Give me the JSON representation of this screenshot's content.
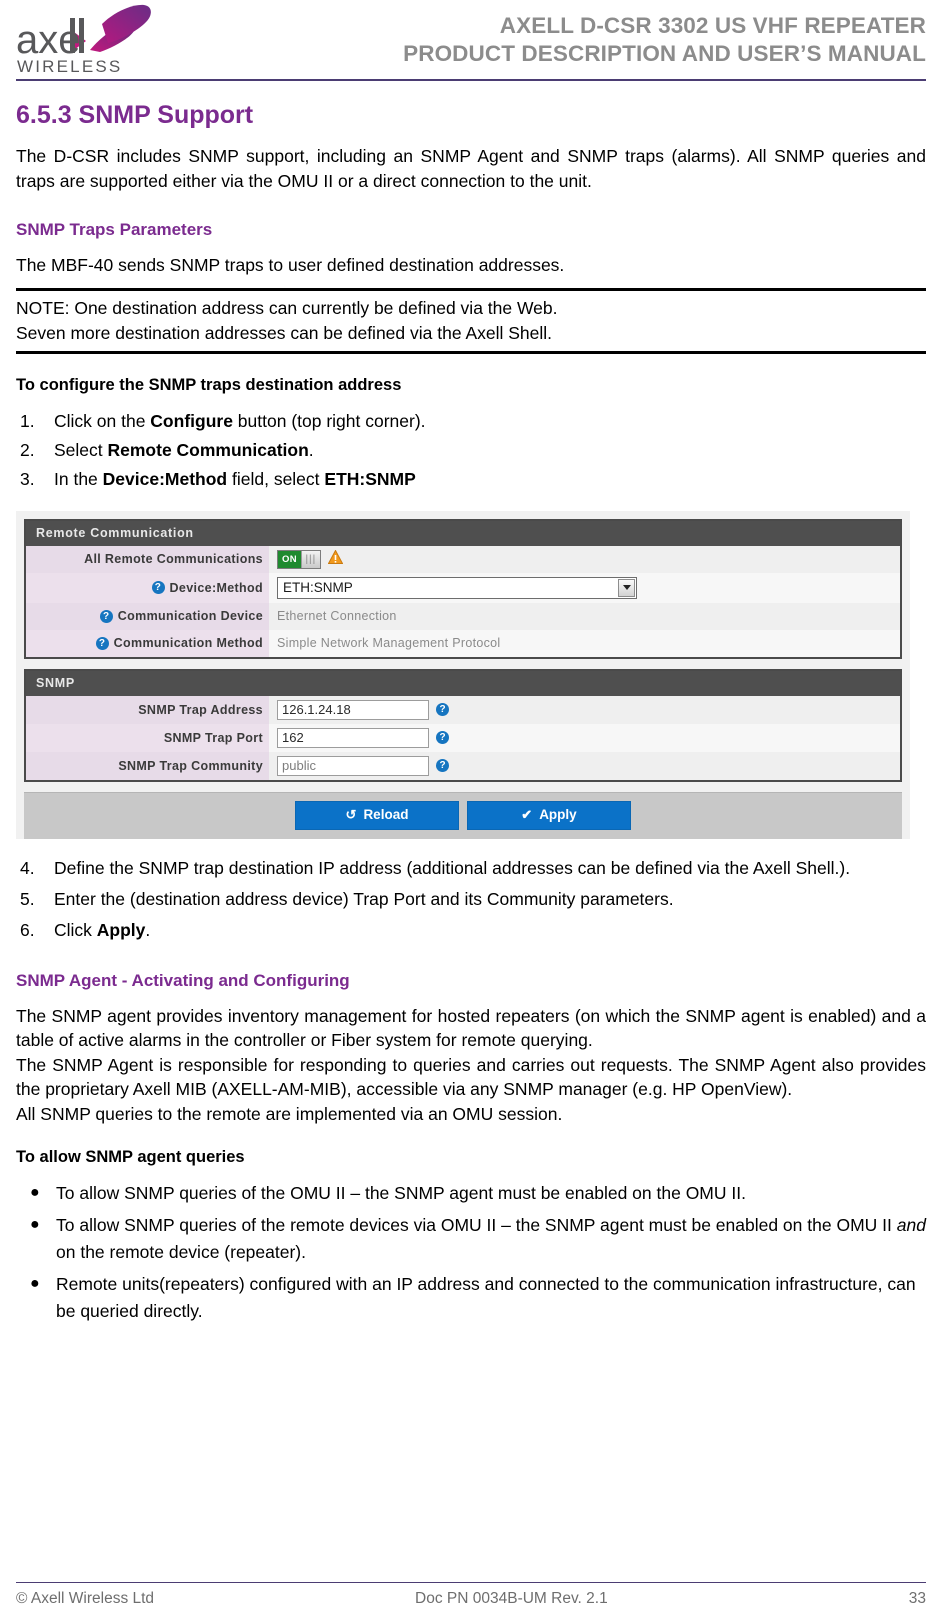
{
  "header": {
    "logo_word": "axell",
    "logo_sub": "WIRELESS",
    "title_line1": "AXELL D-CSR 3302 US VHF REPEATER",
    "title_line2": "PRODUCT DESCRIPTION AND USER’S MANUAL",
    "rule_color": "#4b3d73",
    "title_color": "#8c8c8c"
  },
  "section": {
    "heading": "6.5.3 SNMP Support",
    "heading_color": "#7b2b8f",
    "intro": "The D-CSR includes SNMP support, including an SNMP Agent and SNMP traps (alarms). All SNMP queries and traps are supported either via the OMU II or a direct connection to the unit.",
    "traps_heading": "SNMP Traps Parameters",
    "traps_intro": "The MBF-40 sends SNMP traps to user defined destination addresses.",
    "note_line1": "NOTE: One destination address can currently be defined via the Web.",
    "note_line2": "Seven more destination addresses can be defined via the Axell Shell.",
    "procedure_heading": "To configure the SNMP traps destination address",
    "steps_before": [
      {
        "num": "1.",
        "pre": "Click on the ",
        "bold": "Configure",
        "post": " button (top right corner)."
      },
      {
        "num": "2.",
        "pre": "Select ",
        "bold": "Remote Communication",
        "post": "."
      },
      {
        "num": "3.",
        "pre": "In the ",
        "bold": "Device:Method",
        "post": " field, select ",
        "bold2": "ETH:SNMP",
        "post2": ""
      }
    ],
    "steps_after": [
      {
        "num": "4.",
        "text": "Define the SNMP trap destination IP address (additional addresses can be defined via the Axell Shell.)."
      },
      {
        "num": "5.",
        "text": "Enter the (destination address device) Trap Port and its Community parameters."
      },
      {
        "num": "6.",
        "pre": "Click ",
        "bold": "Apply",
        "post": "."
      }
    ],
    "agent_heading": "SNMP Agent - Activating and Configuring",
    "agent_p1": "The SNMP agent provides inventory management for hosted repeaters (on which the SNMP agent is enabled) and a table of active alarms in the controller or Fiber system for remote querying.",
    "agent_p2": "The SNMP  Agent is  responsible  for  responding  to  queries  and  carries  out  requests.  The SNMP Agent also provides the proprietary Axell MIB (AXELL-AM-MIB), accessible via any SNMP manager (e.g. HP OpenView).",
    "agent_p3": "All SNMP queries to the remote are implemented via an OMU session.",
    "queries_heading": "To allow SNMP agent queries",
    "bullets": [
      {
        "text": "To allow SNMP queries of the OMU II – the SNMP agent must be enabled on the OMU II."
      },
      {
        "pre": "To allow SNMP queries of the remote devices via OMU II – the SNMP agent must be enabled on the OMU II ",
        "italic": "and",
        "post": " on the remote device (repeater)."
      },
      {
        "text": "Remote units(repeaters)  configured with an IP address and connected to the communication infrastructure, can be queried directly."
      }
    ]
  },
  "ui": {
    "panel1_title": "Remote Communication",
    "panel2_title": "SNMP",
    "rows1": [
      {
        "label": "All Remote Communications",
        "has_help": false,
        "kind": "toggle",
        "toggle_label": "ON"
      },
      {
        "label": "Device:Method",
        "has_help": true,
        "kind": "select",
        "value": "ETH:SNMP"
      },
      {
        "label": "Communication Device",
        "has_help": true,
        "kind": "static",
        "value": "Ethernet Connection"
      },
      {
        "label": "Communication Method",
        "has_help": true,
        "kind": "static",
        "value": "Simple Network Management Protocol"
      }
    ],
    "rows2": [
      {
        "label": "SNMP Trap Address",
        "kind": "input",
        "value": "126.1.24.18",
        "is_placeholder": false
      },
      {
        "label": "SNMP Trap Port",
        "kind": "input",
        "value": "162",
        "is_placeholder": false
      },
      {
        "label": "SNMP Trap Community",
        "kind": "input",
        "value": "public",
        "is_placeholder": true
      }
    ],
    "buttons": [
      {
        "icon": "reload-icon",
        "glyph": "↺",
        "label": "Reload"
      },
      {
        "icon": "check-icon",
        "glyph": "✔",
        "label": "Apply"
      }
    ],
    "colors": {
      "panel_header_bg": "#4f4f4f",
      "label_bg": "#e7dbe8",
      "button_blue": "#0b72c8",
      "toggle_green": "#1f8a2f",
      "help_blue": "#1675c0"
    }
  },
  "footer": {
    "left": "© Axell Wireless Ltd",
    "center": "Doc PN 0034B-UM Rev. 2.1",
    "right": "33"
  }
}
